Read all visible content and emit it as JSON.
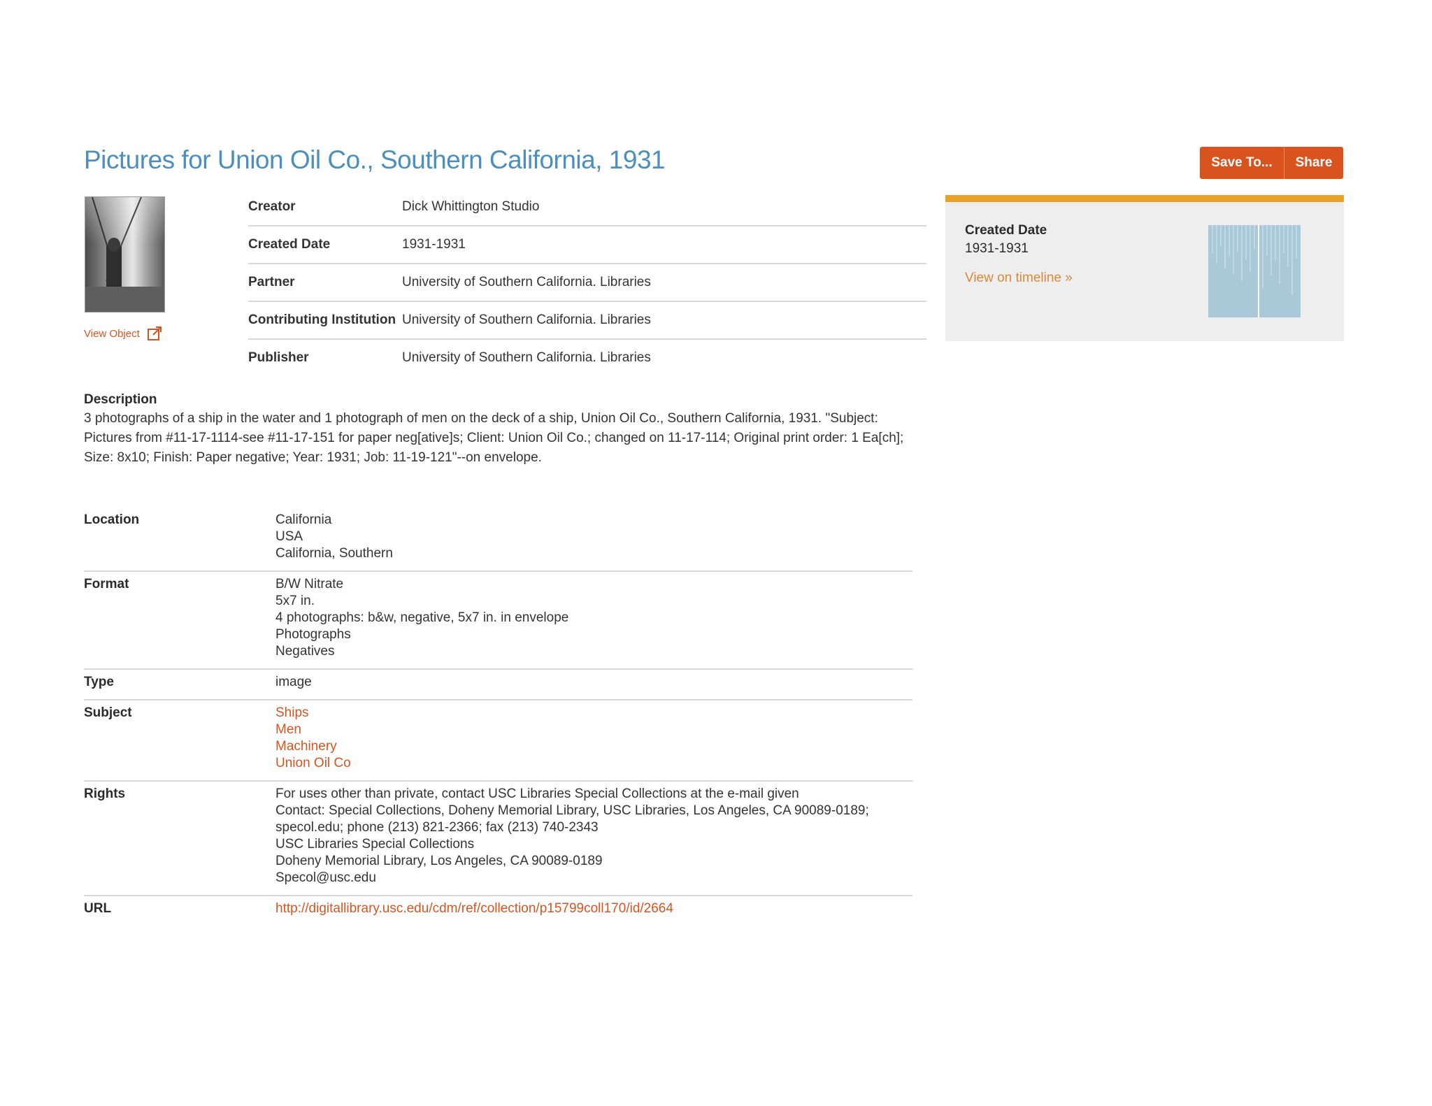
{
  "header": {
    "title": "Pictures for Union Oil Co., Southern California, 1931",
    "save_label": "Save To...",
    "share_label": "Share"
  },
  "thumbnail": {
    "view_object_label": "View Object"
  },
  "meta": [
    {
      "label": "Creator",
      "value": "Dick Whittington Studio"
    },
    {
      "label": "Created Date",
      "value": "1931-1931"
    },
    {
      "label": "Partner",
      "value": "University of Southern California. Libraries"
    },
    {
      "label": "Contributing Institution",
      "value": "University of Southern California. Libraries"
    },
    {
      "label": "Publisher",
      "value": "University of Southern California. Libraries"
    }
  ],
  "description": {
    "label": "Description",
    "text": "3 photographs of a ship in the water and 1 photograph of men on the deck of a ship, Union Oil Co., Southern California, 1931. \"Subject: Pictures from #11-17-1114-see #11-17-151 for paper neg[ative]s; Client: Union Oil Co.; changed on 11-17-114; Original print order: 1 Ea[ch]; Size: 8x10; Finish: Paper negative; Year: 1931; Job: 11-19-121\"--on envelope."
  },
  "details": {
    "location": {
      "label": "Location",
      "values": [
        "California",
        "USA",
        "California, Southern"
      ]
    },
    "format": {
      "label": "Format",
      "values": [
        "B/W Nitrate",
        "5x7 in.",
        "4 photographs: b&w, negative, 5x7 in. in envelope",
        "Photographs",
        "Negatives"
      ]
    },
    "type": {
      "label": "Type",
      "values": [
        "image"
      ]
    },
    "subject": {
      "label": "Subject",
      "values": [
        "Ships",
        "Men",
        "Machinery",
        "Union Oil Co"
      ]
    },
    "rights": {
      "label": "Rights",
      "values": [
        "For uses other than private, contact USC Libraries Special Collections at the e-mail given",
        "Contact: Special Collections, Doheny Memorial Library, USC Libraries, Los Angeles, CA 90089-0189;",
        "specol.edu; phone (213) 821-2366; fax (213) 740-2343",
        "USC Libraries Special Collections",
        "Doheny Memorial Library, Los Angeles, CA 90089-0189",
        "Specol@usc.edu"
      ]
    },
    "url": {
      "label": "URL",
      "value": "http://digitallibrary.usc.edu/cdm/ref/collection/p15799coll170/id/2664"
    }
  },
  "sidebar": {
    "label": "Created Date",
    "value": "1931-1931",
    "timeline_link": "View on timeline »"
  },
  "colors": {
    "title": "#4a8fbf",
    "accent": "#d9531e",
    "sidebar_bar": "#e8a22a",
    "timeline": "#a9c9d9"
  }
}
